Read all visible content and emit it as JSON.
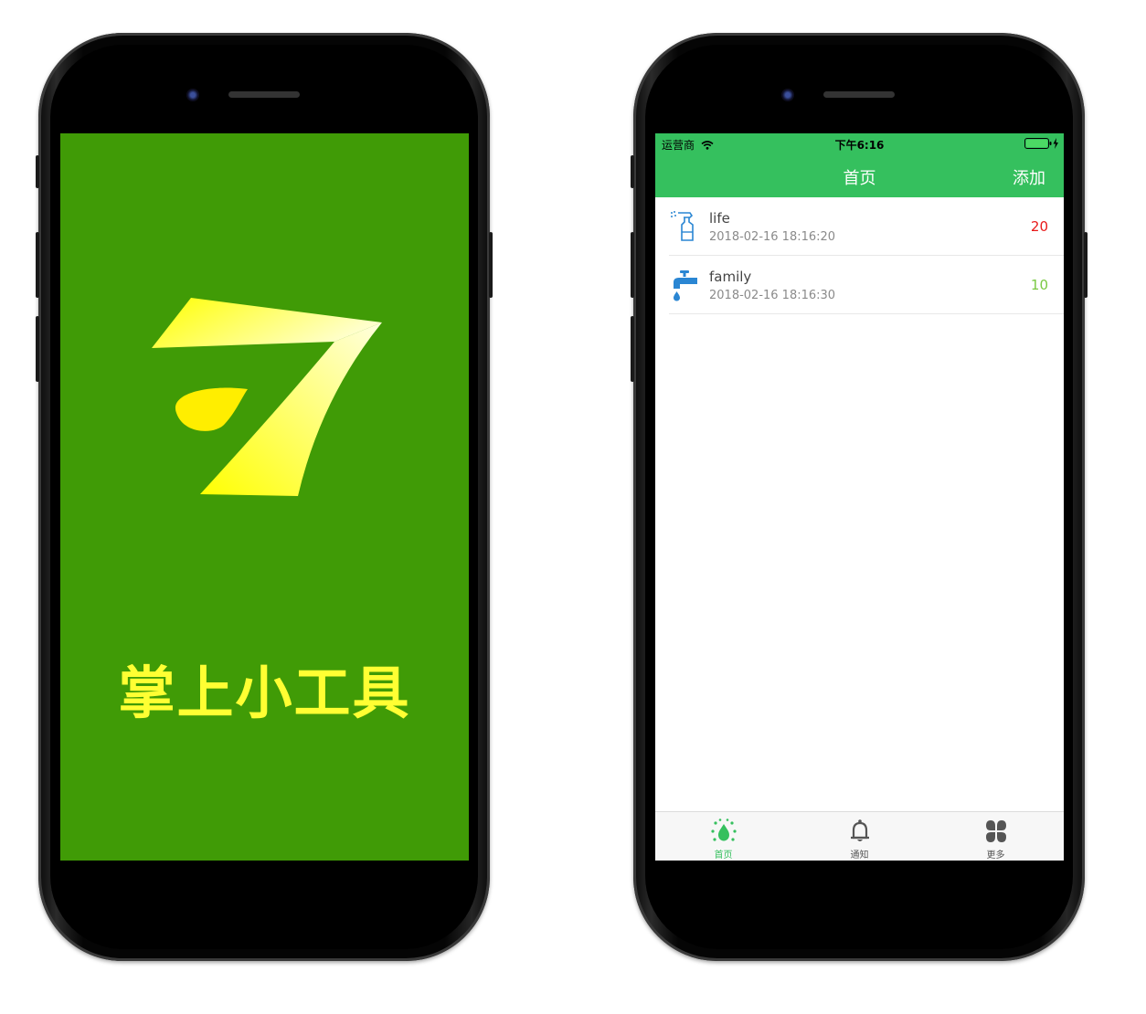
{
  "splash": {
    "app_name": "掌上小工具",
    "background_color": "#409b06",
    "logo_icon": "yellow-seven-leaf-logo"
  },
  "app": {
    "status_bar": {
      "carrier": "运营商",
      "time": "下午6:16",
      "wifi_icon": "wifi-icon",
      "battery_icon": "battery-charging-icon"
    },
    "nav_bar": {
      "title": "首页",
      "add_label": "添加",
      "color": "#35c05e"
    },
    "list": [
      {
        "icon": "spray-bottle-icon",
        "title": "life",
        "time": "2018-02-16 18:16:20",
        "count": "20",
        "count_color": "#e81919"
      },
      {
        "icon": "water-tap-icon",
        "title": "family",
        "time": "2018-02-16 18:16:30",
        "count": "10",
        "count_color": "#7ac943"
      }
    ],
    "tab_bar": {
      "selected": "首页",
      "items": [
        {
          "label": "首页",
          "icon": "water-drop-icon"
        },
        {
          "label": "通知",
          "icon": "bell-icon"
        },
        {
          "label": "更多",
          "icon": "clover-grid-icon"
        }
      ]
    }
  }
}
